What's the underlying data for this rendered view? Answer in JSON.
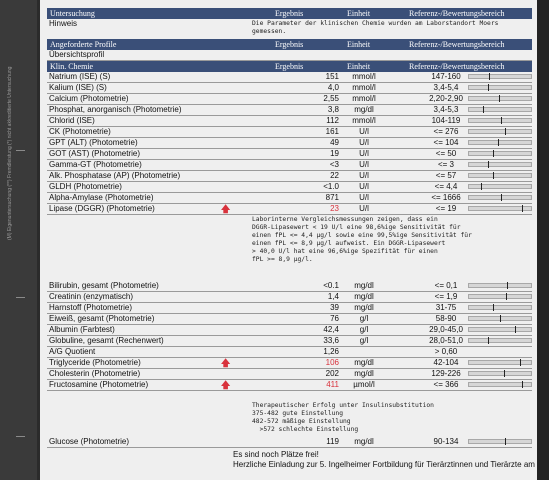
{
  "margin_note": "(M) Eigenuntersuchung (**) Fremdleistung (*) nicht akkreditierte Untersuchung",
  "section1": {
    "headers": [
      "Untersuchung",
      "Ergebnis",
      "Einheit",
      "Referenz-/Bewertungsbereich"
    ],
    "hinweis_label": "Hinweis",
    "hinweis_text": "Die Parameter der klinischen Chemie wurden am Laborstandort Moers\ngemessen."
  },
  "section2": {
    "headers": [
      "Angeforderte Profile",
      "Ergebnis",
      "Einheit",
      "Referenz-/Bewertungsbereich"
    ],
    "profile": "Übersichtsprofil"
  },
  "section3": {
    "headers": [
      "Klin. Chemie",
      "Ergebnis",
      "Einheit",
      "Referenz-/Bewertungsbereich"
    ]
  },
  "rows_a": [
    {
      "name": "Natrium (ISE) (S)",
      "result": "151",
      "unit": "mmol/l",
      "ref": "147-160",
      "level": 0.32
    },
    {
      "name": "Kalium (ISE) (S)",
      "result": "4,0",
      "unit": "mmol/l",
      "ref": "3,4-5,4",
      "level": 0.3
    },
    {
      "name": "Calcium (Photometrie)",
      "result": "2,55",
      "unit": "mmol/l",
      "ref": "2,20-2,90",
      "level": 0.48
    },
    {
      "name": "Phosphat, anorganisch (Photometrie)",
      "result": "3,8",
      "unit": "mg/dl",
      "ref": "3,4-5,3",
      "level": 0.22
    },
    {
      "name": "Chlorid (ISE)",
      "result": "112",
      "unit": "mmol/l",
      "ref": "104-119",
      "level": 0.52
    },
    {
      "name": "CK (Photometrie)",
      "result": "161",
      "unit": "U/l",
      "ref": "<= 276",
      "level": 0.58
    },
    {
      "name": "GPT (ALT) (Photometrie)",
      "result": "49",
      "unit": "U/l",
      "ref": "<= 104",
      "level": 0.46
    },
    {
      "name": "GOT (AST) (Photometrie)",
      "result": "19",
      "unit": "U/l",
      "ref": "<= 50",
      "level": 0.38
    },
    {
      "name": "Gamma-GT (Photometrie)",
      "result": "<3",
      "unit": "U/l",
      "ref": "<= 3",
      "level": 0.3
    },
    {
      "name": "Alk. Phosphatase (AP) (Photometrie)",
      "result": "22",
      "unit": "U/l",
      "ref": "<= 57",
      "level": 0.38
    },
    {
      "name": "GLDH (Photometrie)",
      "result": "<1.0",
      "unit": "U/l",
      "ref": "<= 4,4",
      "level": 0.2
    },
    {
      "name": "Alpha-Amylase (Photometrie)",
      "result": "871",
      "unit": "U/l",
      "ref": "<= 1666",
      "level": 0.52
    }
  ],
  "lipase": {
    "name": "Lipase (DGGR) (Photometrie)",
    "result": "23",
    "unit": "U/l",
    "ref": "<= 19",
    "level": 0.86,
    "flag": "🡅"
  },
  "lipase_note": "Laborinterne Vergleichsmessungen zeigen, dass ein\nDGGR-Lipasewert < 19 U/l eine 98,6%ige Sensitivität für\neinen fPL <= 4,4 µg/l sowie eine 99,5%ige Sensitivität für\neinen fPL <= 8,9 µg/l aufweist. Ein DGGR-Lipasewert\n> 40,0 U/l hat eine 96,6%ige Spezifität für einen\nfPL >= 8,9 µg/l.",
  "rows_b": [
    {
      "name": "Bilirubin, gesamt (Photometrie)",
      "result": "<0.1",
      "unit": "mg/dl",
      "ref": "<= 0,1",
      "level": 0.62
    },
    {
      "name": "Creatinin (enzymatisch)",
      "result": "1,4",
      "unit": "mg/dl",
      "ref": "<= 1,9",
      "level": 0.6
    },
    {
      "name": "Harnstoff (Photometrie)",
      "result": "39",
      "unit": "mg/dl",
      "ref": "31-75",
      "level": 0.38
    },
    {
      "name": "Eiweiß, gesamt (Photometrie)",
      "result": "76",
      "unit": "g/l",
      "ref": "58-90",
      "level": 0.5
    },
    {
      "name": "Albumin (Farbtest)",
      "result": "42,4",
      "unit": "g/l",
      "ref": "29,0-45,0",
      "level": 0.74
    },
    {
      "name": "Globuline, gesamt (Rechenwert)",
      "result": "33,6",
      "unit": "g/l",
      "ref": "28,0-51,0",
      "level": 0.3
    },
    {
      "name": "A/G Quotient",
      "result": "1,26",
      "unit": "",
      "ref": "> 0,60",
      "level": null
    }
  ],
  "rows_c": [
    {
      "name": "Triglyceride (Photometrie)",
      "result": "106",
      "unit": "mg/dl",
      "ref": "42-104",
      "level": 0.82,
      "flag": "🡅"
    },
    {
      "name": "Cholesterin (Photometrie)",
      "result": "202",
      "unit": "mg/dl",
      "ref": "129-226",
      "level": 0.56,
      "flag": ""
    },
    {
      "name": "Fructosamine (Photometrie)",
      "result": "411",
      "unit": "µmol/l",
      "ref": "<= 366",
      "level": 0.86,
      "flag": "🡅"
    }
  ],
  "fructosamine_note": "Therapeutischer Erfolg unter Insulinsubstitution\n375-482 gute Einstellung\n482-572 mäßige Einstellung\n  >572 schlechte Einstellung",
  "glucose": {
    "name": "Glucose (Photometrie)",
    "result": "119",
    "unit": "mg/dl",
    "ref": "90-134",
    "level": 0.58
  },
  "footer": {
    "line1": "Es sind noch Plätze frei!",
    "line2": "Herzliche Einladung zur 5. Ingelheimer Fortbildung für Tierärztinnen und Tierärzte am"
  },
  "colors": {
    "header_bg": "#3a4f78",
    "flag_red": "#d8323c",
    "paper": "#efefef"
  }
}
